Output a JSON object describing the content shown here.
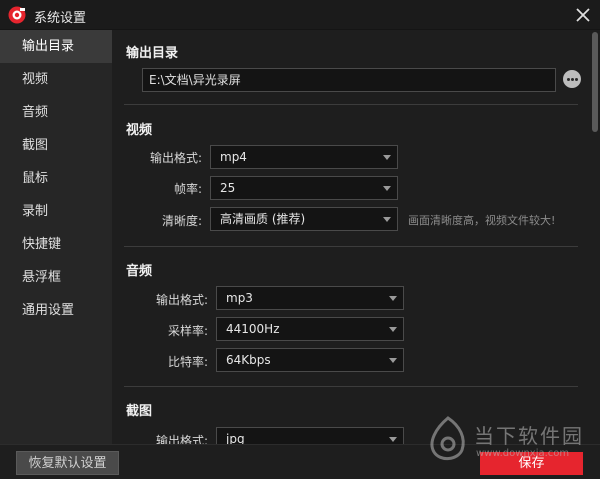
{
  "window": {
    "title": "系统设置"
  },
  "sidebar": {
    "items": [
      {
        "label": "输出目录",
        "active": true
      },
      {
        "label": "视频"
      },
      {
        "label": "音频"
      },
      {
        "label": "截图"
      },
      {
        "label": "鼠标"
      },
      {
        "label": "录制"
      },
      {
        "label": "快捷键"
      },
      {
        "label": "悬浮框"
      },
      {
        "label": "通用设置"
      }
    ]
  },
  "output": {
    "title": "输出目录",
    "path": "E:\\文档\\异光录屏"
  },
  "video": {
    "title": "视频",
    "format_label": "输出格式:",
    "format_value": "mp4",
    "fps_label": "帧率:",
    "fps_value": "25",
    "quality_label": "清晰度:",
    "quality_value": "高清画质 (推荐)",
    "quality_hint": "画面清晰度高，视频文件较大!"
  },
  "audio": {
    "title": "音频",
    "format_label": "输出格式:",
    "format_value": "mp3",
    "samplerate_label": "采样率:",
    "samplerate_value": "44100Hz",
    "bitrate_label": "比特率:",
    "bitrate_value": "64Kbps"
  },
  "screenshot": {
    "title": "截图",
    "format_label": "输出格式:",
    "format_value": "jpg"
  },
  "footer": {
    "reset_label": "恢复默认设置",
    "save_label": "保存"
  },
  "watermark": {
    "text": "当下软件园",
    "url": "www.downxia.com"
  },
  "colors": {
    "accent": "#e6252e",
    "background": "#1e1e1e",
    "sidebar": "#262626"
  }
}
